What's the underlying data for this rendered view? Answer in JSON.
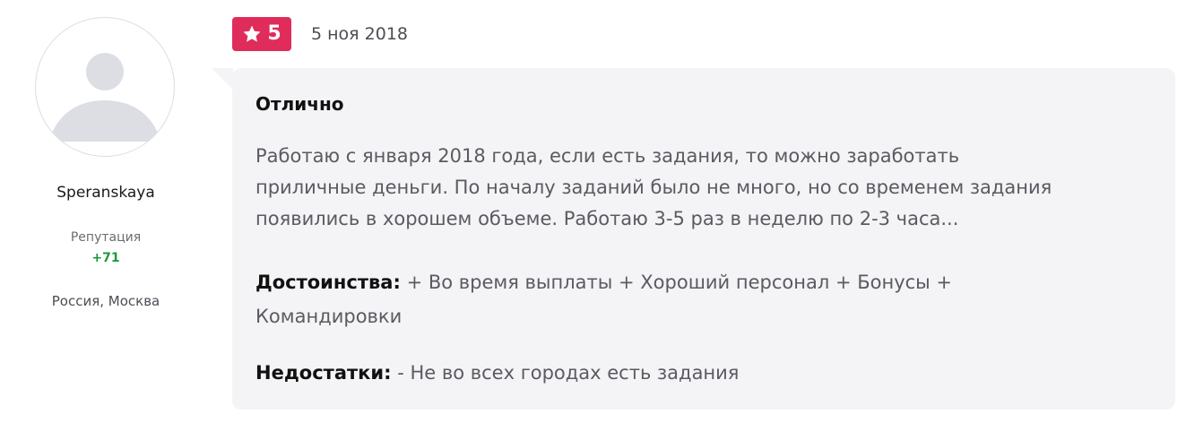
{
  "author": {
    "name": "Speranskaya",
    "reputation_label": "Репутация",
    "reputation_value": "+71",
    "location": "Россия, Москва"
  },
  "review": {
    "rating": "5",
    "date": "5 ноя 2018",
    "title": "Отлично",
    "body_lines": [
      "Работаю с января 2018 года, если есть задания, то можно заработать",
      "приличные деньги. По началу заданий было не много, но со временем задания",
      "появились в хорошем объеме. Работаю 3-5 раз в неделю по 2-3 часа..."
    ],
    "pros_label": "Достоинства:",
    "pros_lines": [
      " + Во время выплаты + Хороший персонал + Бонусы +",
      "Командировки"
    ],
    "cons_label": "Недостатки:",
    "cons_text": " - Не во всех городах есть задания"
  },
  "icons": {
    "avatar": "user-placeholder-icon",
    "rating": "star-icon"
  },
  "colors": {
    "rating_badge": "#e02c5b",
    "reputation_positive": "#1d9a3f",
    "bubble_background": "#f4f4f6",
    "avatar_placeholder": "#dcdee3"
  }
}
